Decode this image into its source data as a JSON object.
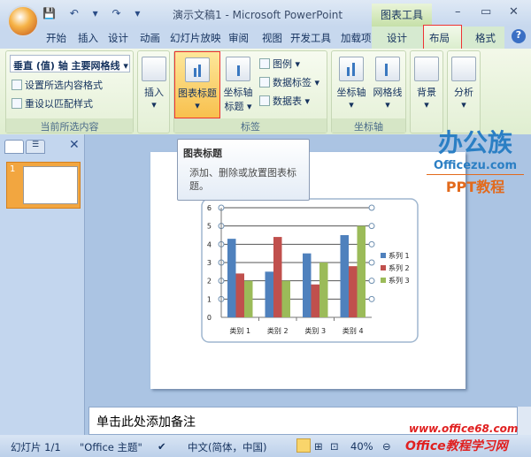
{
  "window": {
    "title": "演示文稿1 - Microsoft PowerPoint",
    "context_tool": "图表工具",
    "qat": "💾 ↶ ▾ ↷ ▾"
  },
  "tabs": [
    "开始",
    "插入",
    "设计",
    "动画",
    "幻灯片放映",
    "审阅",
    "视图",
    "开发工具",
    "加载项",
    "设计",
    "布局",
    "格式"
  ],
  "ribbon": {
    "current_selection": {
      "dropdown": "垂直 (值) 轴 主要网格线",
      "format": "设置所选内容格式",
      "reset": "重设以匹配样式",
      "label": "当前所选内容"
    },
    "insert": {
      "label": "插入"
    },
    "labels": {
      "chart_title": "图表标题",
      "axis_title_1": "坐标轴",
      "axis_title_2": "标题",
      "legend": "图例",
      "data_labels": "数据标签",
      "data_table": "数据表",
      "label": "标签"
    },
    "axes": {
      "axes": "坐标轴",
      "gridlines": "网格线",
      "label": "坐标轴"
    },
    "background": {
      "label": "背景"
    },
    "analysis": {
      "label": "分析"
    }
  },
  "tooltip": {
    "title": "图表标题",
    "body": "添加、删除或放置图表标题。"
  },
  "thumbnail": {
    "number": "1"
  },
  "notes": {
    "placeholder": "单击此处添加备注"
  },
  "status": {
    "slide": "幻灯片 1/1",
    "theme": "\"Office 主题\"",
    "language": "中文(简体，中国)",
    "zoom": "40%"
  },
  "watermark": {
    "logo_text": "办公族",
    "site": "Officezu.com",
    "sub": "PPT教程",
    "footer_1": "Office教程学习网",
    "footer_2": "www.office68.com"
  },
  "chart_data": {
    "type": "bar",
    "categories": [
      "类别 1",
      "类别 2",
      "类别 3",
      "类别 4"
    ],
    "series": [
      {
        "name": "系列 1",
        "values": [
          4.3,
          2.5,
          3.5,
          4.5
        ],
        "color": "#4f81bd"
      },
      {
        "name": "系列 2",
        "values": [
          2.4,
          4.4,
          1.8,
          2.8
        ],
        "color": "#c0504d"
      },
      {
        "name": "系列 3",
        "values": [
          2.0,
          2.0,
          3.0,
          5.0
        ],
        "color": "#9bbb59"
      }
    ],
    "ylim": [
      0,
      6
    ],
    "yticks": [
      "0",
      "1",
      "2",
      "3",
      "4",
      "5",
      "6"
    ],
    "grid": true,
    "legend": "right",
    "selected": "vertical-axis-major-gridlines"
  }
}
